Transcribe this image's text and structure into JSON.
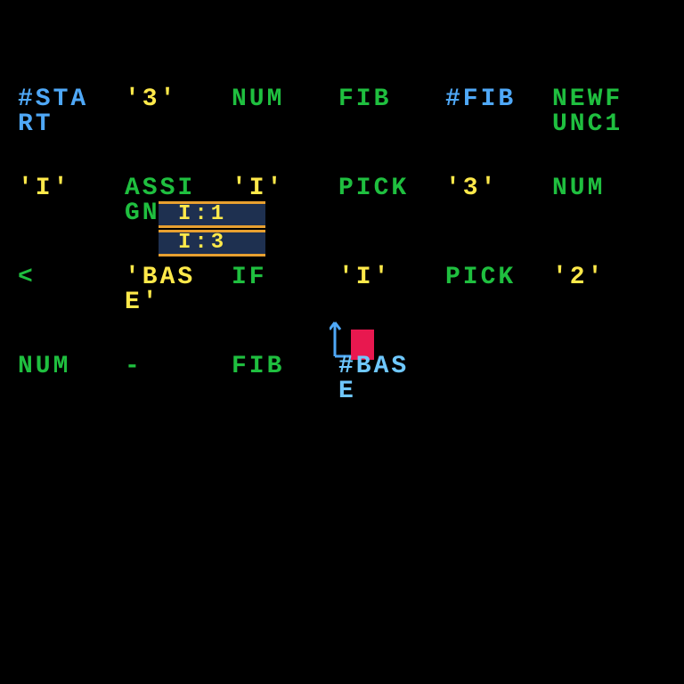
{
  "grid": {
    "row0": {
      "c0": "#STA\nRT",
      "c1": "'3'",
      "c2": "NUM",
      "c3": "FIB",
      "c4": "#FIB",
      "c5": "NEWF\nUNC1"
    },
    "row1": {
      "c0": "'I'",
      "c1": "ASSI\nGN",
      "c2": "'I'",
      "c3": "PICK",
      "c4": "'3'",
      "c5": "NUM"
    },
    "row2": {
      "c0": "<",
      "c1": "'BAS\nE'",
      "c2": "IF",
      "c3": "'I'",
      "c4": "PICK",
      "c5": "'2'"
    },
    "row3": {
      "c0": "NUM",
      "c1": "-",
      "c2": "FIB",
      "c3": "#BAS\nE"
    }
  },
  "tooltip": {
    "line1": "I:1",
    "line2": "I:3"
  },
  "colors": {
    "blue": "#4FA8F7",
    "yellow": "#FFE94A",
    "green": "#1FBF3F",
    "lightblue": "#6FC8FF",
    "red": "#E8184F",
    "overlay": "#1E3050",
    "overlayBorder": "#E8A030"
  }
}
